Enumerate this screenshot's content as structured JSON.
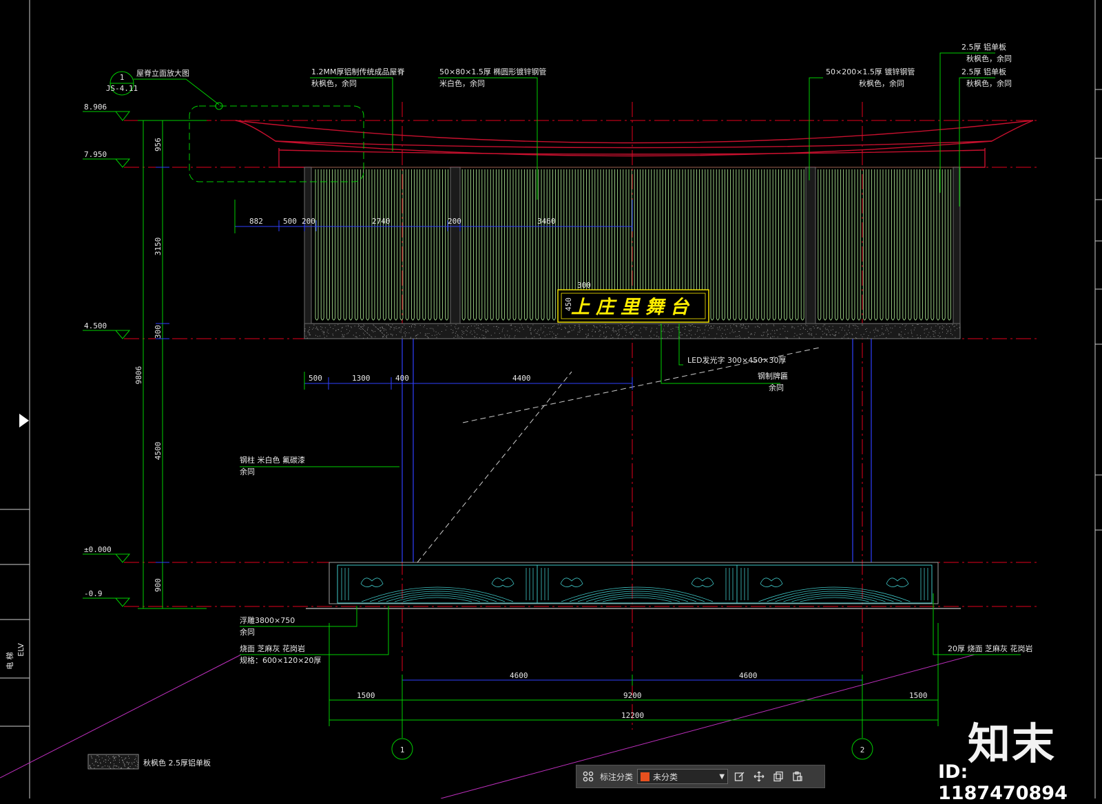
{
  "colors": {
    "bg": "#000000",
    "roof": "#c8102e",
    "axis": "#e3001b",
    "dim": "#00d000",
    "dimblue": "#3040ff",
    "leader": "#00d000",
    "panel": "#a8e090",
    "sign": "#ffee00",
    "base": "#40c8c8",
    "magenta": "#c030c0",
    "white": "#e8e8e8"
  },
  "elevations": [
    {
      "label": "8.906",
      "value": 8.906
    },
    {
      "label": "7.950",
      "value": 7.95
    },
    {
      "label": "4.500",
      "value": 4.5
    },
    {
      "label": "±0.000",
      "value": 0
    },
    {
      "label": "-0.9",
      "value": -0.9
    }
  ],
  "vertical_dims": {
    "total": "9806",
    "segments": [
      "956",
      "3150",
      "300",
      "4500",
      "900"
    ]
  },
  "detail_callout": {
    "number": "1",
    "ref": "JS-4.11",
    "title": "屋脊立面放大图"
  },
  "notes": {
    "roof1_a": "1.2MM厚铝制传统成品屋脊",
    "roof1_b": "秋枫色，余同",
    "pipe1_a": "50×80×1.5厚 椭圆形镀锌钢管",
    "pipe1_b": "米白色，余同",
    "pipe2_a": "50×200×1.5厚 镀锌钢管",
    "pipe2_b": "秋枫色，余同",
    "alu1_a": "2.5厚 铝单板",
    "alu1_b": "秋枫色，余同",
    "alu2_a": "2.5厚 铝单板",
    "alu2_b": "秋枫色，余同",
    "led_a": "LED发光字 300×450×30厚",
    "led_b": "钢制牌匾",
    "led_c": "余同",
    "column_a": "钢柱 米白色 氟碳漆",
    "column_b": "余同",
    "relief_a": "浮雕3800×750",
    "relief_b": "余同",
    "paving_a": "烧面 芝麻灰 花岗岩",
    "paving_b": "规格：600×120×20厚",
    "paving_right": "20厚 烧面 芝麻灰 花岗岩",
    "legend": "秋枫色 2.5厚铝单板"
  },
  "sign_text": "上庄里舞台",
  "sign_dims": {
    "w": "300",
    "h": "450"
  },
  "top_dims": [
    "882",
    "500",
    "200",
    "2740",
    "200",
    "3460"
  ],
  "mid_dims": [
    "500",
    "1300",
    "400",
    "4400"
  ],
  "bottom_dims": {
    "row1": [
      "4600",
      "4600"
    ],
    "row2": [
      "1500",
      "9200",
      "1500"
    ],
    "row3": [
      "12200"
    ]
  },
  "axes": [
    "1",
    "2"
  ],
  "side_label": {
    "a": "电 梯",
    "b": "ELV"
  },
  "toolbar": {
    "label": "标注分类",
    "selected": "未分类"
  },
  "watermark": {
    "brand": "知末",
    "id": "ID: 1187470894"
  }
}
